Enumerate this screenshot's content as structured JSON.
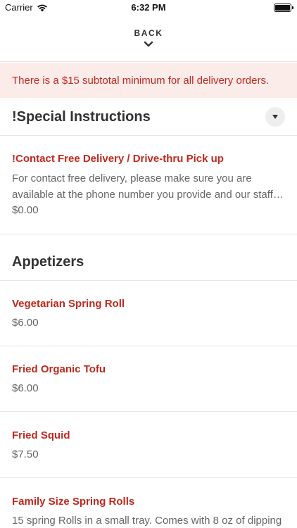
{
  "status_bar": {
    "carrier": "Carrier",
    "time": "6:32 PM"
  },
  "header": {
    "back_label": "BACK"
  },
  "banner": {
    "text": "There is a $15 subtotal minimum for all delivery orders."
  },
  "sections": [
    {
      "title": "!Special Instructions",
      "items": [
        {
          "name": "!Contact Free Delivery / Drive-thru Pick up",
          "description": "For contact free delivery, please make sure you are available at the phone number you provide and our staff will call you when the order arrives.",
          "price": "$0.00"
        }
      ]
    },
    {
      "title": "Appetizers",
      "items": [
        {
          "name": "Vegetarian Spring Roll",
          "price": "$6.00"
        },
        {
          "name": "Fried Organic Tofu",
          "price": "$6.00"
        },
        {
          "name": "Fried Squid",
          "price": "$7.50"
        },
        {
          "name": "Family Size Spring Rolls",
          "description": "15 spring Rolls in a small tray.  Comes with 8 oz of dipping"
        }
      ]
    }
  ],
  "colors": {
    "accent": "#c0281e",
    "banner_bg": "#fbecea",
    "divider": "#e6e6e6"
  },
  "icons": {
    "signal": "wifi-icon",
    "battery": "battery-icon",
    "back": "chevron-down-icon",
    "collapse": "caret-down-icon"
  }
}
